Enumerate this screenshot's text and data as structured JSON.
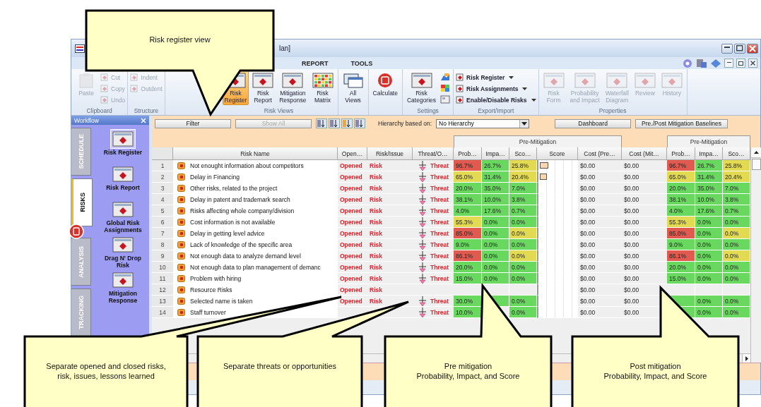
{
  "window": {
    "title": "lan]"
  },
  "menu_tabs": [
    {
      "label": "REPORT",
      "selected": false
    },
    {
      "label": "TOOLS",
      "selected": false
    }
  ],
  "ribbon": {
    "groups": [
      {
        "label": "Clipboard",
        "items": [
          {
            "kind": "large",
            "label": "Paste",
            "disabled": true
          },
          {
            "kind": "column",
            "items": [
              {
                "label": "Cut",
                "disabled": true
              },
              {
                "label": "Copy",
                "disabled": true
              },
              {
                "label": "Undo",
                "disabled": true
              }
            ]
          }
        ]
      },
      {
        "label": "Structure",
        "items": [
          {
            "kind": "column",
            "items": [
              {
                "label": "Indent",
                "disabled": true
              },
              {
                "label": "Outdent",
                "disabled": true
              }
            ]
          }
        ]
      },
      {
        "label": "Risk Views",
        "items": [
          {
            "kind": "large",
            "label": "Risk\nRegister",
            "selected": true
          },
          {
            "kind": "large",
            "label": "Risk\nReport",
            "selected": false
          },
          {
            "kind": "large",
            "label": "Mitigation\nResponse",
            "selected": false
          },
          {
            "kind": "large",
            "label": "Risk\nMatrix",
            "selected": false
          }
        ]
      },
      {
        "items": [
          {
            "kind": "large",
            "label": "All\nViews"
          }
        ]
      },
      {
        "items": [
          {
            "kind": "large",
            "label": "Calculate"
          }
        ]
      },
      {
        "label": "Settings",
        "items": [
          {
            "kind": "large",
            "label": "Risk\nCategories"
          },
          {
            "kind": "icon_column"
          }
        ]
      },
      {
        "label": "Export/Import",
        "items": [
          {
            "kind": "column",
            "items": [
              {
                "label": "Risk Register",
                "dropdown": true
              },
              {
                "label": "Risk Assignments",
                "dropdown": true
              },
              {
                "label": "Enable/Disable Risks",
                "dropdown": true
              }
            ]
          }
        ]
      },
      {
        "label": "Properties",
        "items": [
          {
            "kind": "large",
            "label": "Risk\nForm",
            "disabled": true
          },
          {
            "kind": "large",
            "label": "Probability\nand Impact",
            "disabled": true
          },
          {
            "kind": "large",
            "label": "Waterfall\nDiagram",
            "disabled": true
          },
          {
            "kind": "large",
            "label": "Review",
            "disabled": true
          },
          {
            "kind": "large",
            "label": "History",
            "disabled": true
          }
        ]
      }
    ]
  },
  "sidebar": {
    "title": "Workflow",
    "tabs": [
      {
        "label": "SCHEDULE",
        "selected": false
      },
      {
        "label": "RISKS",
        "selected": true
      },
      {
        "label": "ANALYSIS",
        "selected": false
      },
      {
        "label": "TRACKING",
        "selected": false
      }
    ],
    "items": [
      {
        "label": "Risk Register",
        "selected": true
      },
      {
        "label": "Risk Report",
        "selected": false
      },
      {
        "label": "Global Risk Assignments",
        "selected": false
      },
      {
        "label": "Drag N' Drop Risk",
        "selected": false
      },
      {
        "label": "Mitigation Response",
        "selected": false
      }
    ]
  },
  "toolbar": {
    "filter": "Filter",
    "show_all": {
      "label": "Show All",
      "disabled": true
    },
    "hierarchy_label": "Hierarchy based on:",
    "hierarchy_value": "No Hierarchy",
    "buttons": [
      "Dashboard",
      "Pre./Post Mitigation Baselines"
    ]
  },
  "table": {
    "column_groups": [
      {
        "columns": [
          "Risk Name",
          "Open…",
          "Risk/Issue",
          "Threat/O…"
        ]
      },
      {
        "label": "Pre-Mitigation",
        "columns": [
          "Prob…",
          "Impa…",
          "Sco…",
          "Score",
          "Cost (Pre…"
        ]
      },
      {
        "columns": [
          "Cost (Mit…"
        ]
      },
      {
        "label": "Pre-Mitigation",
        "columns": [
          "Prob…",
          "Impa…",
          "Sco…"
        ]
      }
    ],
    "rows": [
      {
        "number": "1",
        "name": "Not enought information about competitors",
        "status": "Opened",
        "type": "Risk",
        "threat": "Threat",
        "pre": [
          {
            "text": "96.7%",
            "color": "#e05a4f"
          },
          {
            "text": "26.7%",
            "color": "#68d85f"
          },
          {
            "text": "25.8%",
            "color": "#e2da52"
          }
        ],
        "score_bar": {
          "level": 0.24
        },
        "cost_pre": "$0.00",
        "cost_mit": "$0.00",
        "post": [
          {
            "text": "96.7%",
            "color": "#e05a4f"
          },
          {
            "text": "26.7%",
            "color": "#68d85f"
          },
          {
            "text": "25.8%",
            "color": "#e2da52"
          }
        ]
      },
      {
        "number": "2",
        "name": "Delay in Financing",
        "status": "Opened",
        "type": "Risk",
        "threat": "Threat",
        "pre": [
          {
            "text": "65.0%",
            "color": "#e2da52"
          },
          {
            "text": "31.4%",
            "color": "#68d85f"
          },
          {
            "text": "20.4%",
            "color": "#e2da52"
          }
        ],
        "score_bar": {
          "level": 0.19
        },
        "cost_pre": "$0.00",
        "cost_mit": "$0.00",
        "post": [
          {
            "text": "65.0%",
            "color": "#e2da52"
          },
          {
            "text": "31.4%",
            "color": "#68d85f"
          },
          {
            "text": "20.4%",
            "color": "#e2da52"
          }
        ]
      },
      {
        "number": "3",
        "name": "Other risks, related to the project",
        "status": "Opened",
        "type": "Risk",
        "threat": "Threat",
        "pre": [
          {
            "text": "20.0%",
            "color": "#68d85f"
          },
          {
            "text": "35.0%",
            "color": "#68d85f"
          },
          {
            "text": "7.0%",
            "color": "#68d85f"
          }
        ],
        "cost_pre": "$0.00",
        "cost_mit": "$0.00",
        "post": [
          {
            "text": "20.0%",
            "color": "#68d85f"
          },
          {
            "text": "35.0%",
            "color": "#68d85f"
          },
          {
            "text": "7.0%",
            "color": "#68d85f"
          }
        ]
      },
      {
        "number": "4",
        "name": "Delay in patent and trademark search",
        "status": "Opened",
        "type": "Risk",
        "threat": "Threat",
        "pre": [
          {
            "text": "38.1%",
            "color": "#68d85f"
          },
          {
            "text": "10.0%",
            "color": "#68d85f"
          },
          {
            "text": "3.8%",
            "color": "#68d85f"
          }
        ],
        "cost_pre": "$0.00",
        "cost_mit": "$0.00",
        "post": [
          {
            "text": "38.1%",
            "color": "#68d85f"
          },
          {
            "text": "10.0%",
            "color": "#68d85f"
          },
          {
            "text": "3.8%",
            "color": "#68d85f"
          }
        ]
      },
      {
        "number": "5",
        "name": "Risks affecting whole company/division",
        "status": "Opened",
        "type": "Risk",
        "threat": "Threat",
        "pre": [
          {
            "text": "4.0%",
            "color": "#68d85f"
          },
          {
            "text": "17.6%",
            "color": "#68d85f"
          },
          {
            "text": "0.7%",
            "color": "#68d85f"
          }
        ],
        "cost_pre": "$0.00",
        "cost_mit": "$0.00",
        "post": [
          {
            "text": "4.0%",
            "color": "#68d85f"
          },
          {
            "text": "17.6%",
            "color": "#68d85f"
          },
          {
            "text": "0.7%",
            "color": "#68d85f"
          }
        ]
      },
      {
        "number": "6",
        "name": "Cost information is not available",
        "status": "Opened",
        "type": "Risk",
        "threat": "Threat",
        "pre": [
          {
            "text": "55.3%",
            "color": "#e2da52"
          },
          {
            "text": "0.0%",
            "color": "#68d85f"
          },
          {
            "text": "0.0%",
            "color": "#68d85f"
          }
        ],
        "cost_pre": "$0.00",
        "cost_mit": "$0.00",
        "post": [
          {
            "text": "55.3%",
            "color": "#e2da52"
          },
          {
            "text": "0.0%",
            "color": "#68d85f"
          },
          {
            "text": "0.0%",
            "color": "#68d85f"
          }
        ]
      },
      {
        "number": "7",
        "name": "Delay in getting level advice",
        "status": "Opened",
        "type": "Risk",
        "threat": "Threat",
        "pre": [
          {
            "text": "85.0%",
            "color": "#e05a4f"
          },
          {
            "text": "0.0%",
            "color": "#68d85f"
          },
          {
            "text": "0.0%",
            "color": "#e2da52"
          }
        ],
        "cost_pre": "$0.00",
        "cost_mit": "$0.00",
        "post": [
          {
            "text": "85.0%",
            "color": "#e05a4f"
          },
          {
            "text": "0.0%",
            "color": "#68d85f"
          },
          {
            "text": "0.0%",
            "color": "#e2da52"
          }
        ]
      },
      {
        "number": "8",
        "name": "Lack of knowledge of the specific area",
        "status": "Opened",
        "type": "Risk",
        "threat": "Threat",
        "pre": [
          {
            "text": "9.0%",
            "color": "#68d85f"
          },
          {
            "text": "0.0%",
            "color": "#68d85f"
          },
          {
            "text": "0.0%",
            "color": "#68d85f"
          }
        ],
        "cost_pre": "$0.00",
        "cost_mit": "$0.00",
        "post": [
          {
            "text": "9.0%",
            "color": "#68d85f"
          },
          {
            "text": "0.0%",
            "color": "#68d85f"
          },
          {
            "text": "0.0%",
            "color": "#68d85f"
          }
        ]
      },
      {
        "number": "9",
        "name": "Not enough data to analyze demand level",
        "status": "Opened",
        "type": "Risk",
        "threat": "Threat",
        "pre": [
          {
            "text": "86.1%",
            "color": "#e05a4f"
          },
          {
            "text": "0.0%",
            "color": "#68d85f"
          },
          {
            "text": "0.0%",
            "color": "#e2da52"
          }
        ],
        "cost_pre": "$0.00",
        "cost_mit": "$0.00",
        "post": [
          {
            "text": "86.1%",
            "color": "#e05a4f"
          },
          {
            "text": "0.0%",
            "color": "#68d85f"
          },
          {
            "text": "0.0%",
            "color": "#e2da52"
          }
        ]
      },
      {
        "number": "10",
        "name": "Not enough data to plan management of demanc",
        "status": "Opened",
        "type": "Risk",
        "threat": "Threat",
        "pre": [
          {
            "text": "20.0%",
            "color": "#68d85f"
          },
          {
            "text": "0.0%",
            "color": "#68d85f"
          },
          {
            "text": "0.0%",
            "color": "#68d85f"
          }
        ],
        "cost_pre": "$0.00",
        "cost_mit": "$0.00",
        "post": [
          {
            "text": "20.0%",
            "color": "#68d85f"
          },
          {
            "text": "0.0%",
            "color": "#68d85f"
          },
          {
            "text": "0.0%",
            "color": "#68d85f"
          }
        ]
      },
      {
        "number": "11",
        "name": "Problem with hiring",
        "status": "Opened",
        "type": "Risk",
        "threat": "Threat",
        "pre": [
          {
            "text": "15.0%",
            "color": "#68d85f"
          },
          {
            "text": "0.0%",
            "color": "#68d85f"
          },
          {
            "text": "0.0%",
            "color": "#68d85f"
          }
        ],
        "cost_pre": "$0.00",
        "cost_mit": "$0.00",
        "post": [
          {
            "text": "15.0%",
            "color": "#68d85f"
          },
          {
            "text": "0.0%",
            "color": "#68d85f"
          },
          {
            "text": "0.0%",
            "color": "#68d85f"
          }
        ]
      },
      {
        "number": "12",
        "name": "Resource Risks",
        "status": "Opened",
        "type": "Risk",
        "cost_pre": "$0.00",
        "cost_mit": "$0.00"
      },
      {
        "number": "13",
        "name": "Selected name is taken",
        "status": "Opened",
        "type": "Risk",
        "threat": "Threat",
        "pre": [
          {
            "text": "30.0%",
            "color": "#68d85f"
          },
          {
            "color": "#68d85f"
          },
          {
            "text": "0.0%",
            "color": "#68d85f"
          }
        ],
        "cost_pre": "$0.00",
        "cost_mit": "$0.00",
        "post": [
          {
            "color": "#68d85f"
          },
          {
            "text": "0.0%",
            "color": "#68d85f"
          },
          {
            "text": "0.0%",
            "color": "#68d85f"
          }
        ]
      },
      {
        "number": "14",
        "name": "Staff turnover",
        "threat": "Threat",
        "pre": [
          {
            "text": "10.0%",
            "color": "#68d85f"
          },
          {
            "covered": true
          },
          {
            "text": "0.0%",
            "color": "#68d85f"
          }
        ],
        "cost_pre": "$0.00",
        "cost_mit": "$0.00",
        "post": [
          {
            "color": "#68d85f"
          },
          {
            "text": "0.0%",
            "color": "#68d85f"
          },
          {
            "text": "0.0%",
            "color": "#68d85f"
          }
        ]
      }
    ]
  },
  "callouts": [
    {
      "text": "Risk register view"
    },
    {
      "text": "Separate opened and closed risks,\nrisk, issues, lessons learned"
    },
    {
      "text": "Separate threats or opportunities"
    },
    {
      "text": "Pre mitigation\nProbability, Impact, and Score"
    },
    {
      "text": "Post mitigation\nProbability, Impact, and Score"
    }
  ]
}
